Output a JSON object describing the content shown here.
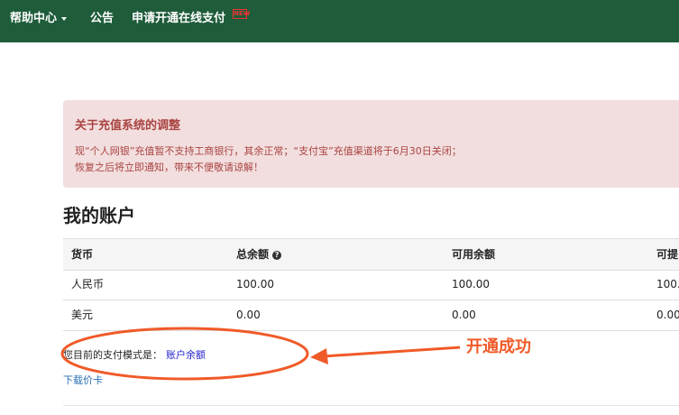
{
  "navbar": {
    "help_center": "帮助中心",
    "announcement": "公告",
    "apply_online_payment": "申请开通在线支付"
  },
  "alert": {
    "title": "关于充值系统的调整",
    "line1": "现“个人网银”充值暂不支持工商银行，其余正常；“支付宝”充值渠道将于6月30日关闭；",
    "line2": "恢复之后将立即通知，带来不便敬请谅解！"
  },
  "page_title": "我的账户",
  "table": {
    "headers": [
      "货币",
      "总余额",
      "可用余额",
      "可提"
    ],
    "rows": [
      [
        "人民币",
        "100.00",
        "100.00",
        "100."
      ],
      [
        "美元",
        "0.00",
        "0.00",
        "0.00"
      ]
    ]
  },
  "payment": {
    "label": "您目前的支付模式是：",
    "mode": "账户余额"
  },
  "download_card": "下载价卡",
  "annotation": {
    "label": "开通成功",
    "color": "#f05a28"
  },
  "colors": {
    "navbar": "#1e5c3a",
    "alert_bg": "#f2dede",
    "alert_text": "#a94442",
    "link": "#2222cc"
  },
  "icons": {
    "dropdown": "caret-down-icon",
    "new": "new-badge-icon",
    "help": "question-circle-icon"
  }
}
